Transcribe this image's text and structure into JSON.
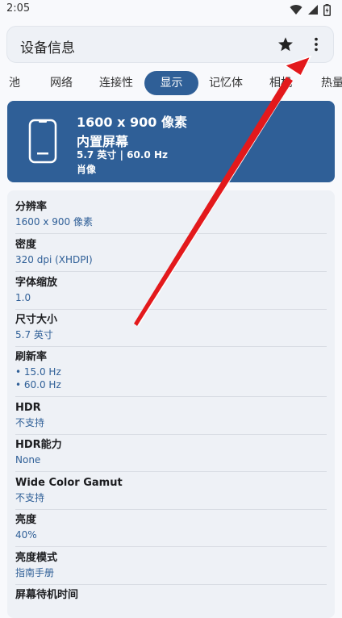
{
  "status": {
    "time": "2:05"
  },
  "appbar": {
    "title": "设备信息"
  },
  "tabs": [
    {
      "label": "池"
    },
    {
      "label": "网络"
    },
    {
      "label": "连接性"
    },
    {
      "label": "显示"
    },
    {
      "label": "记忆体"
    },
    {
      "label": "相机"
    },
    {
      "label": "热量"
    }
  ],
  "hero": {
    "resolution": "1600 x 900 像素",
    "display_type": "内置屏幕",
    "size_refresh": "5.7 英寸 | 60.0 Hz",
    "orientation": "肖像"
  },
  "rows": [
    {
      "label": "分辨率",
      "value": "1600 x 900 像素"
    },
    {
      "label": "密度",
      "value": "320 dpi (XHDPI)"
    },
    {
      "label": "字体缩放",
      "value": "1.0"
    },
    {
      "label": "尺寸大小",
      "value": "5.7 英寸"
    },
    {
      "label": "刷新率",
      "value": "• 15.0 Hz",
      "value2": "• 60.0 Hz"
    },
    {
      "label": "HDR",
      "value": "不支持"
    },
    {
      "label": "HDR能力",
      "value": "None"
    },
    {
      "label": "Wide Color Gamut",
      "value": "不支持"
    },
    {
      "label": "亮度",
      "value": "40%"
    },
    {
      "label": "亮度模式",
      "value": "指南手册"
    },
    {
      "label": "屏幕待机时间",
      "value": ""
    }
  ],
  "colors": {
    "accent": "#2f5f97",
    "annotation_arrow": "#e3191c"
  }
}
